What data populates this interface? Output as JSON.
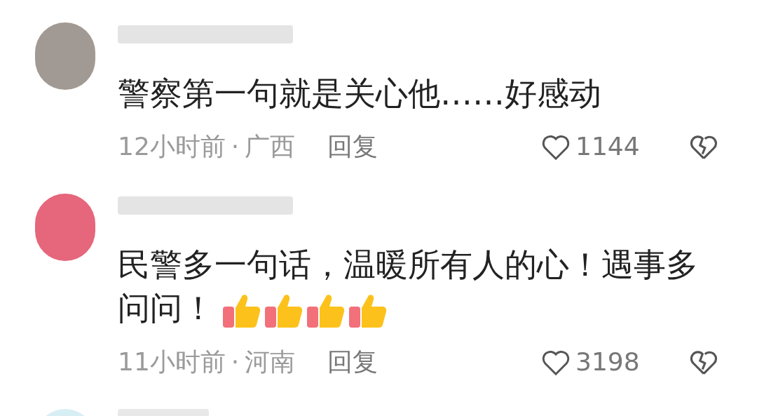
{
  "comments": [
    {
      "text": "警察第一句就是关心他……好感动",
      "time": "12小时前",
      "separator": "·",
      "location": "广西",
      "reply": "回复",
      "likes": "1144",
      "thumbs": false
    },
    {
      "text": "民警多一句话，温暖所有人的心！遇事多问问！",
      "time": "11小时前",
      "separator": "·",
      "location": "河南",
      "reply": "回复",
      "likes": "3198",
      "thumbs": true
    }
  ]
}
